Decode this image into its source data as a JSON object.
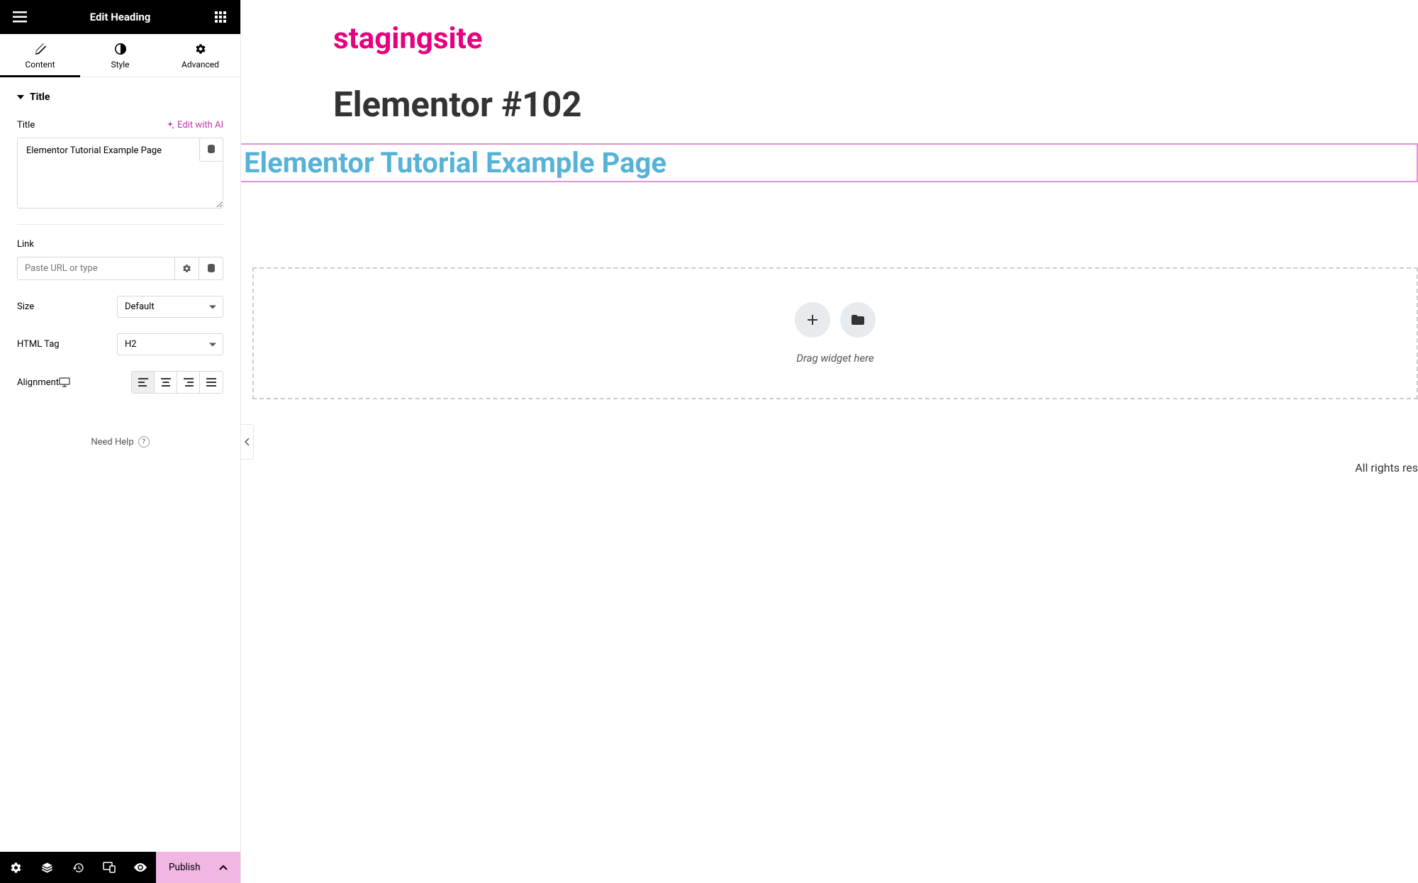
{
  "panel": {
    "title": "Edit Heading",
    "tabs": {
      "content": "Content",
      "style": "Style",
      "advanced": "Advanced"
    }
  },
  "section": {
    "title": "Title"
  },
  "controls": {
    "title_label": "Title",
    "edit_ai": "Edit with AI",
    "title_value": "Elementor Tutorial Example Page",
    "link_label": "Link",
    "link_placeholder": "Paste URL or type",
    "size_label": "Size",
    "size_value": "Default",
    "htmltag_label": "HTML Tag",
    "htmltag_value": "H2",
    "alignment_label": "Alignment"
  },
  "help": "Need Help",
  "footer": {
    "publish": "Publish"
  },
  "canvas": {
    "site_title": "stagingsite",
    "page_title": "Elementor #102",
    "heading_text": "Elementor Tutorial Example Page",
    "drop_hint": "Drag widget here",
    "footer_text": "All rights res"
  }
}
